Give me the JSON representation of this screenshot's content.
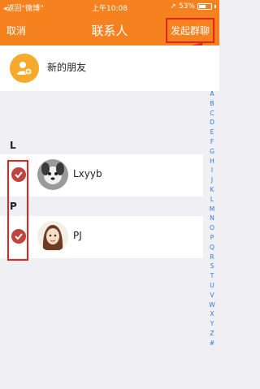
{
  "status_bar": {
    "back_text": "◂返回“微博”",
    "signal": "▂▄▆",
    "time": "上午10:08",
    "location_icon": "location-arrow-icon",
    "battery_percent": "53%",
    "battery_level": 0.53
  },
  "nav": {
    "cancel_label": "取消",
    "title": "联系人",
    "action_label": "发起群聊"
  },
  "new_friend": {
    "label": "新的朋友",
    "icon": "add-person-icon"
  },
  "sections": [
    {
      "letter": "L",
      "contacts": [
        {
          "name": "Lxyyb",
          "selected": true
        }
      ]
    },
    {
      "letter": "P",
      "contacts": [
        {
          "name": "PJ",
          "selected": true
        }
      ]
    }
  ],
  "index_letters": [
    "A",
    "B",
    "C",
    "D",
    "E",
    "F",
    "G",
    "H",
    "I",
    "J",
    "K",
    "L",
    "M",
    "N",
    "O",
    "P",
    "Q",
    "R",
    "S",
    "T",
    "U",
    "V",
    "W",
    "X",
    "Y",
    "Z",
    "#"
  ],
  "colors": {
    "accent_orange": "#f6821f",
    "annotation_red": "#e3251f",
    "check_red": "#c0443e",
    "index_blue": "#2a7bd6"
  }
}
